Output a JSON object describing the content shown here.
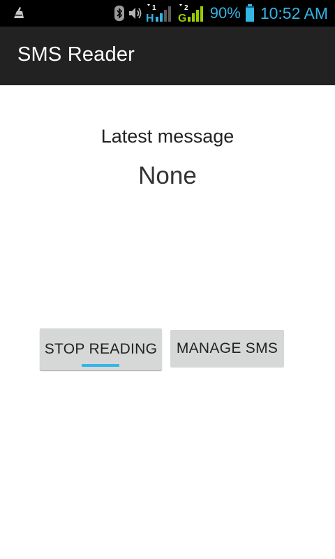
{
  "status_bar": {
    "battery_percent": "90%",
    "time": "10:52 AM",
    "icons": [
      "cleaner-icon",
      "bluetooth-icon",
      "volume-icon",
      "signal-h-icon",
      "signal-g-icon",
      "battery-icon"
    ],
    "sim1_network": "H",
    "sim2_network": "G",
    "sim1_index": "1",
    "sim2_index": "2",
    "accent_color": "#33b5e5"
  },
  "action_bar": {
    "title": "SMS Reader"
  },
  "main": {
    "latest_label": "Latest message",
    "latest_value": "None",
    "stop_button": "STOP READING",
    "manage_button": "MANAGE SMS"
  },
  "colors": {
    "status_bar_bg": "#000000",
    "action_bar_bg": "#222222",
    "button_bg": "#d6d7d7",
    "focus_accent": "#33b5e5"
  }
}
